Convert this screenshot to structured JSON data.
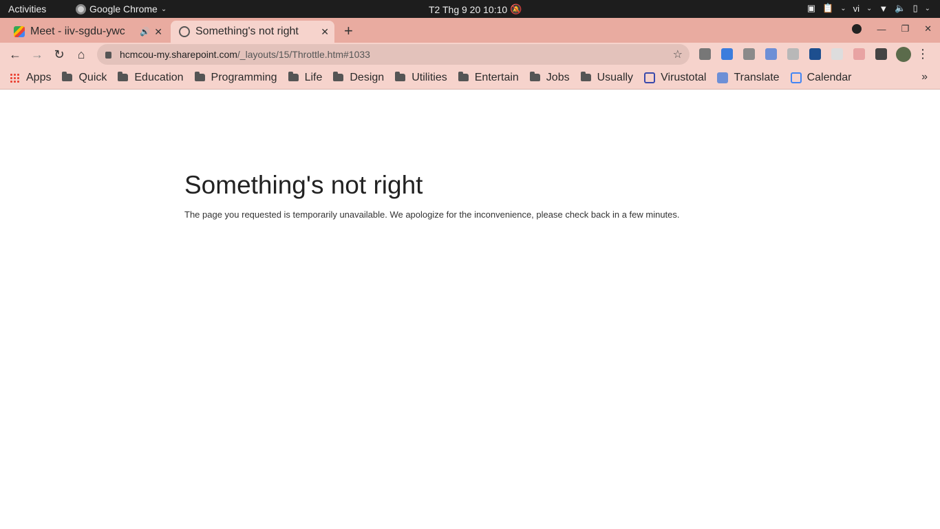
{
  "system_bar": {
    "activities": "Activities",
    "app_name": "Google Chrome",
    "clock": "T2 Thg 9 20  10:10",
    "language": "vi"
  },
  "tabs": [
    {
      "title": "Meet - iiv-sgdu-ywc",
      "icon": "google-meet-icon"
    },
    {
      "title": "Something's not right",
      "icon": "globe-icon"
    }
  ],
  "toolbar": {
    "url_host": "hcmcou-my.sharepoint.com",
    "url_path": "/_layouts/15/Throttle.htm#1033"
  },
  "bookmarks": [
    {
      "label": "Apps"
    },
    {
      "label": "Quick"
    },
    {
      "label": "Education"
    },
    {
      "label": "Programming"
    },
    {
      "label": "Life"
    },
    {
      "label": "Design"
    },
    {
      "label": "Utilities"
    },
    {
      "label": "Entertain"
    },
    {
      "label": "Jobs"
    },
    {
      "label": "Usually"
    },
    {
      "label": "Virustotal"
    },
    {
      "label": "Translate"
    },
    {
      "label": "Calendar"
    }
  ],
  "page": {
    "heading": "Something's not right",
    "message": "The page you requested is temporarily unavailable. We apologize for the inconvenience, please check back in a few minutes."
  },
  "colors": {
    "tab_strip": "#e9aba0",
    "toolbar": "#f6d3cc",
    "system_bar": "#1d1d1d"
  }
}
